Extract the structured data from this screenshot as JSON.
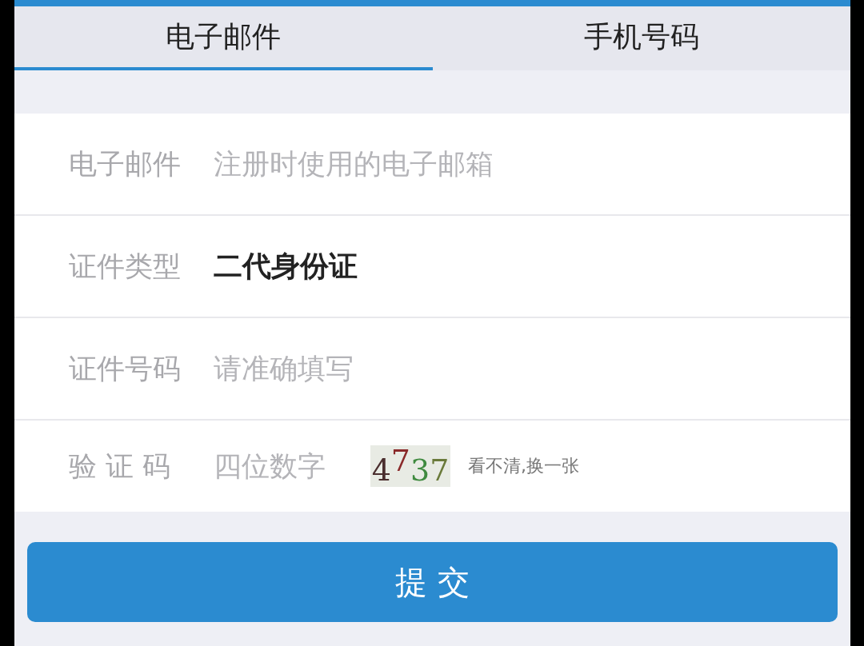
{
  "tabs": [
    {
      "label": "电子邮件",
      "selected": true
    },
    {
      "label": "手机号码",
      "selected": false
    }
  ],
  "fields": [
    {
      "kind": "input",
      "label": "电子邮件",
      "placeholder": "注册时使用的电子邮箱"
    },
    {
      "kind": "select",
      "label": "证件类型",
      "value": "二代身份证"
    },
    {
      "kind": "input",
      "label": "证件号码",
      "placeholder": "请准确填写"
    },
    {
      "kind": "captcha",
      "label": "验 证 码",
      "placeholder": "四位数字",
      "captcha": [
        {
          "char": "4",
          "color": "#4a2e2e"
        },
        {
          "char": "7",
          "color": "#8a2a2a"
        },
        {
          "char": "3",
          "color": "#3f8a3f"
        },
        {
          "char": "7",
          "color": "#6a7a3a"
        }
      ],
      "refresh_link": "看不清,换一张"
    }
  ],
  "submit": "提 交"
}
